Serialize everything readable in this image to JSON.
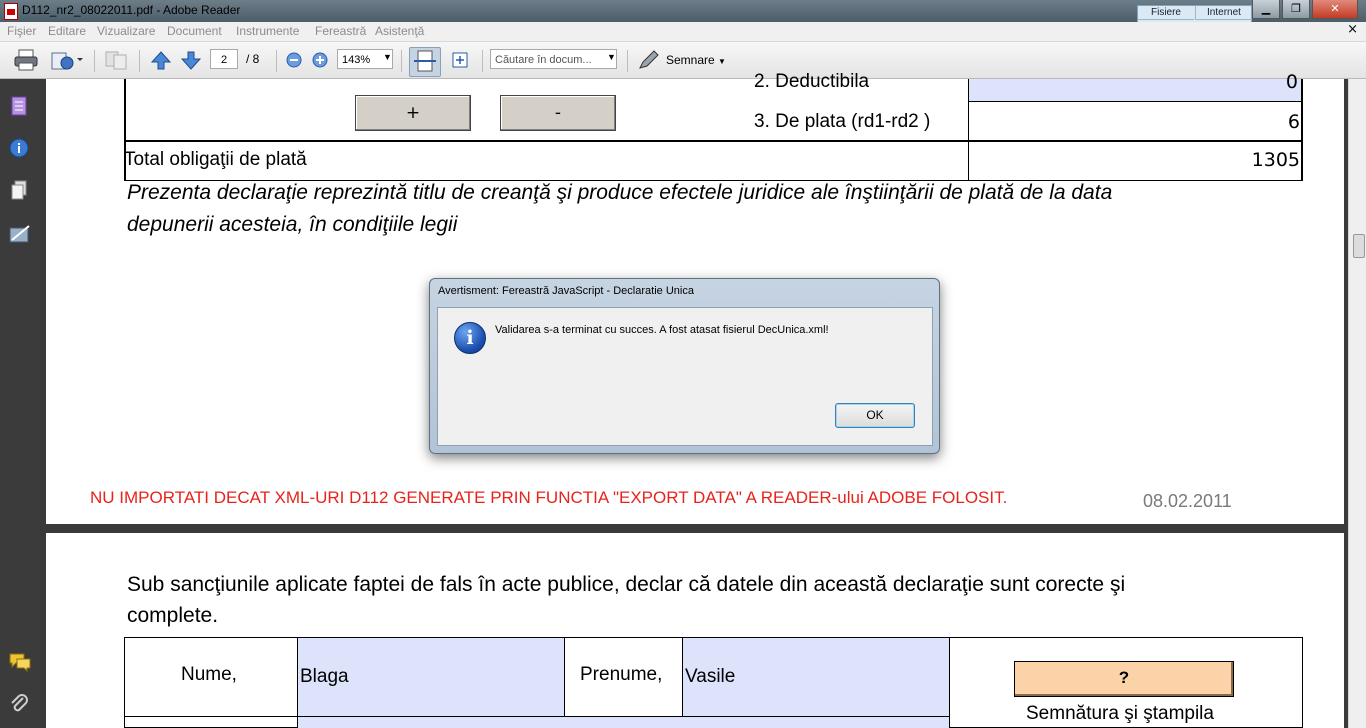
{
  "window": {
    "title": "D112_nr2_08022011.pdf - Adobe Reader",
    "minimize": "▁",
    "maximize": "❐",
    "close": "✕"
  },
  "netmeter": {
    "tab1": "Fisiere",
    "tab2": "Internet"
  },
  "menu": {
    "items": [
      "Fişier",
      "Editare",
      "Vizualizare",
      "Document",
      "Instrumente",
      "Fereastră",
      "Asistenţă"
    ],
    "close": "×"
  },
  "toolbar": {
    "page_current": "2",
    "page_total": "/ 8",
    "zoom": "143%",
    "search_placeholder": "Căutare în docum...",
    "sign_label": "Semnare"
  },
  "page1": {
    "row_deductibila": "2. Deductibila",
    "row_deductibila_value": "0",
    "plus_btn": "+",
    "minus_btn": "-",
    "row_deplata": "3. De plata (rd1-rd2 )",
    "row_deplata_value": "6",
    "total_label": "Total obligaţii de plată",
    "total_value": "1305",
    "statement_line1": "Prezenta declaraţie reprezintă titlu de creanţă şi produce efectele juridice ale înştiinţării de plată de la data",
    "statement_line2": "depunerii acesteia, în condiţiile legii",
    "warning": "NU IMPORTATI DECAT XML-URI D112 GENERATE PRIN FUNCTIA \"EXPORT DATA\" A READER-ului ADOBE FOLOSIT.",
    "date": "08.02.2011"
  },
  "page2": {
    "sanction_line1": "Sub sancţiunile aplicate faptei de fals în acte publice, declar că datele din această declaraţie sunt corecte şi",
    "sanction_line2": "complete.",
    "nume_label": "Nume,",
    "nume_value": "Blaga",
    "prenume_label": "Prenume,",
    "prenume_value": "Vasile",
    "help_btn": "?",
    "signature_label": "Semnătura şi ştampila"
  },
  "dialog": {
    "title": "Avertisment: Fereastră JavaScript - Declaratie Unica",
    "message": "Validarea s-a terminat cu succes. A fost atasat fisierul DecUnica.xml!",
    "ok": "OK"
  },
  "colors": {
    "field_blue": "#dde3fb",
    "warning_red": "#e8231c",
    "button_peach": "#fcd3a9"
  }
}
